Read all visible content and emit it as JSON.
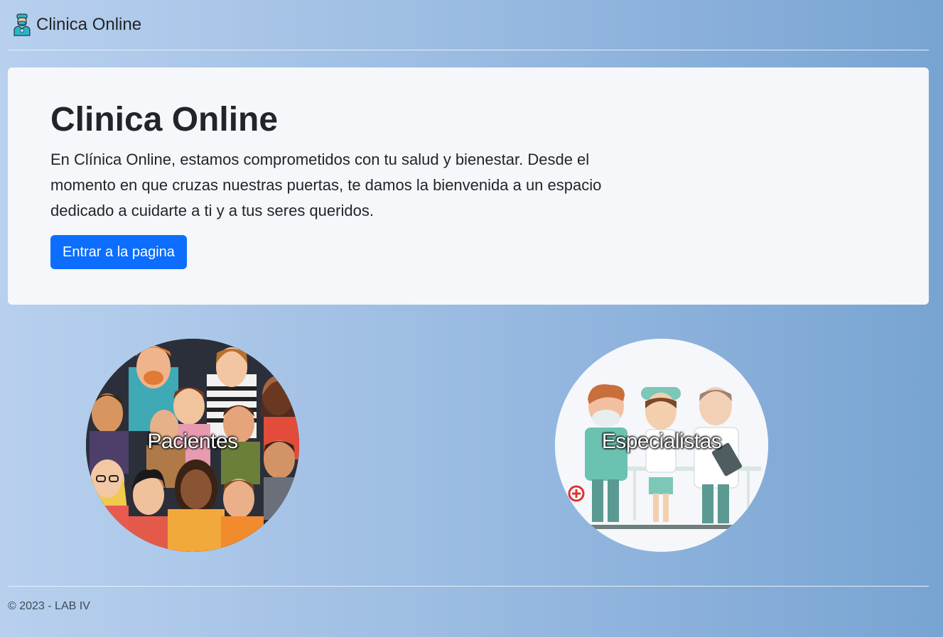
{
  "navbar": {
    "brand_icon": "doctor-icon",
    "brand_text": "Clinica Online"
  },
  "hero": {
    "title": "Clinica Online",
    "description": "En Clínica Online, estamos comprometidos con tu salud y bienestar. Desde el momento en que cruzas nuestras puertas, te damos la bienvenida a un espacio dedicado a cuidarte a ti y a tus seres queridos.",
    "button_label": "Entrar a la pagina",
    "button_color": "#0d6efd"
  },
  "cards": [
    {
      "label": "Pacientes",
      "image": "crowd-of-people-illustration"
    },
    {
      "label": "Especialistas",
      "image": "medical-staff-illustration"
    }
  ],
  "footer": {
    "text": "© 2023 - LAB IV"
  }
}
